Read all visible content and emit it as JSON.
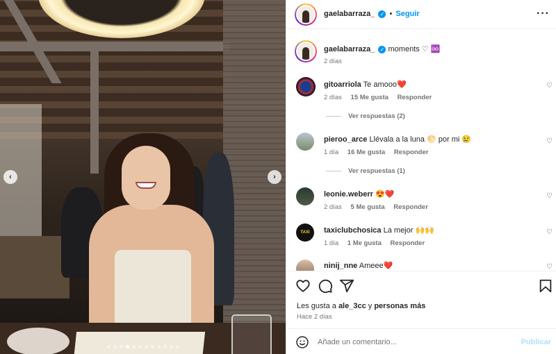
{
  "post": {
    "author": "gaelabarraza_",
    "follow_label": "Seguir",
    "separator": "•",
    "more_glyph": "···"
  },
  "carousel": {
    "slide_count": 12,
    "active_index": 3,
    "prev_glyph": "‹",
    "next_glyph": "›"
  },
  "caption": {
    "author": "gaelabarraza_",
    "text": "moments ♡ ♾️",
    "time": "2 días"
  },
  "comments": [
    {
      "user": "gitoarriola",
      "text": "Te amooo❤️",
      "time": "2 días",
      "likes": "15 Me gusta",
      "reply": "Responder",
      "replies": "Ver respuestas (2)"
    },
    {
      "user": "pieroo_arce",
      "text": "Llévala a la luna 🌕 por mi 😢",
      "time": "1 día",
      "likes": "16 Me gusta",
      "reply": "Responder",
      "replies": "Ver respuestas (1)"
    },
    {
      "user": "leonie.weberr",
      "text": "😍❤️",
      "time": "2 días",
      "likes": "5 Me gusta",
      "reply": "Responder"
    },
    {
      "user": "taxiclubchosica",
      "text": "La mejor 🙌🙌",
      "time": "1 día",
      "likes": "1 Me gusta",
      "reply": "Responder"
    },
    {
      "user": "ninij_nne",
      "text": "Ameee❤️"
    }
  ],
  "likes_line": {
    "prefix": "Les gusta a",
    "user": "ale_3cc",
    "joiner": "y",
    "others": "personas más"
  },
  "posted_ago": "Hace 2 días",
  "add_comment": {
    "placeholder": "Añade un comentario...",
    "post_label": "Publicar"
  },
  "colors": {
    "accent": "#0095f6",
    "muted": "#737373",
    "post_disabled": "#b2dffc"
  }
}
